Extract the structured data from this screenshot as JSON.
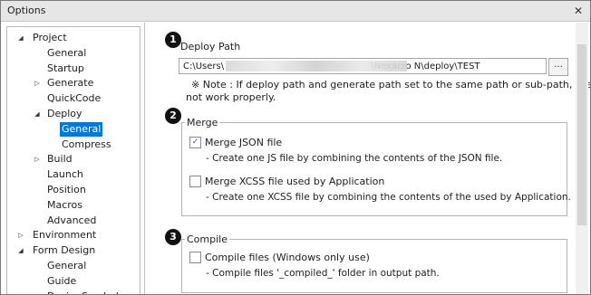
{
  "window": {
    "title": "Options",
    "close_glyph": "✕"
  },
  "tree": [
    {
      "label": "Project",
      "toggle": "◢"
    },
    {
      "label": "General",
      "toggle": ""
    },
    {
      "label": "Startup",
      "toggle": ""
    },
    {
      "label": "Generate",
      "toggle": "▷"
    },
    {
      "label": "QuickCode",
      "toggle": ""
    },
    {
      "label": "Deploy",
      "toggle": "◢"
    },
    {
      "label": "General",
      "toggle": "",
      "selected": true
    },
    {
      "label": "Compress",
      "toggle": ""
    },
    {
      "label": "Build",
      "toggle": "▷"
    },
    {
      "label": "Launch",
      "toggle": ""
    },
    {
      "label": "Position",
      "toggle": ""
    },
    {
      "label": "Macros",
      "toggle": ""
    },
    {
      "label": "Advanced",
      "toggle": ""
    },
    {
      "label": "Environment",
      "toggle": "▷"
    },
    {
      "label": "Form Design",
      "toggle": "◢"
    },
    {
      "label": "General",
      "toggle": ""
    },
    {
      "label": "Guide",
      "toggle": ""
    },
    {
      "label": "DesignSymbol",
      "toggle": ""
    }
  ],
  "deploy": {
    "badge": "1",
    "label": "Deploy Path",
    "path_value": "C:\\Users\\                                                   \\Nexacro N\\deploy\\TEST",
    "browse_label": "...",
    "note_line1": "※ Note : If deploy path and generate path set to the same path or sub-path, the project may",
    "note_line2": "not work properly."
  },
  "merge": {
    "badge": "2",
    "label": "Merge",
    "json_checkbox_glyph": "✓",
    "json_label": "Merge JSON file",
    "json_desc": "- Create one JS file by combining the contents of the JSON file.",
    "xcss_label": "Merge XCSS file used by Application",
    "xcss_desc": "- Create one XCSS file by combining the contents of the used by Application."
  },
  "compile": {
    "badge": "3",
    "label": "Compile",
    "files_label": "Compile files (Windows only use)",
    "files_desc": "- Compile files '_compiled_' folder in output path."
  }
}
